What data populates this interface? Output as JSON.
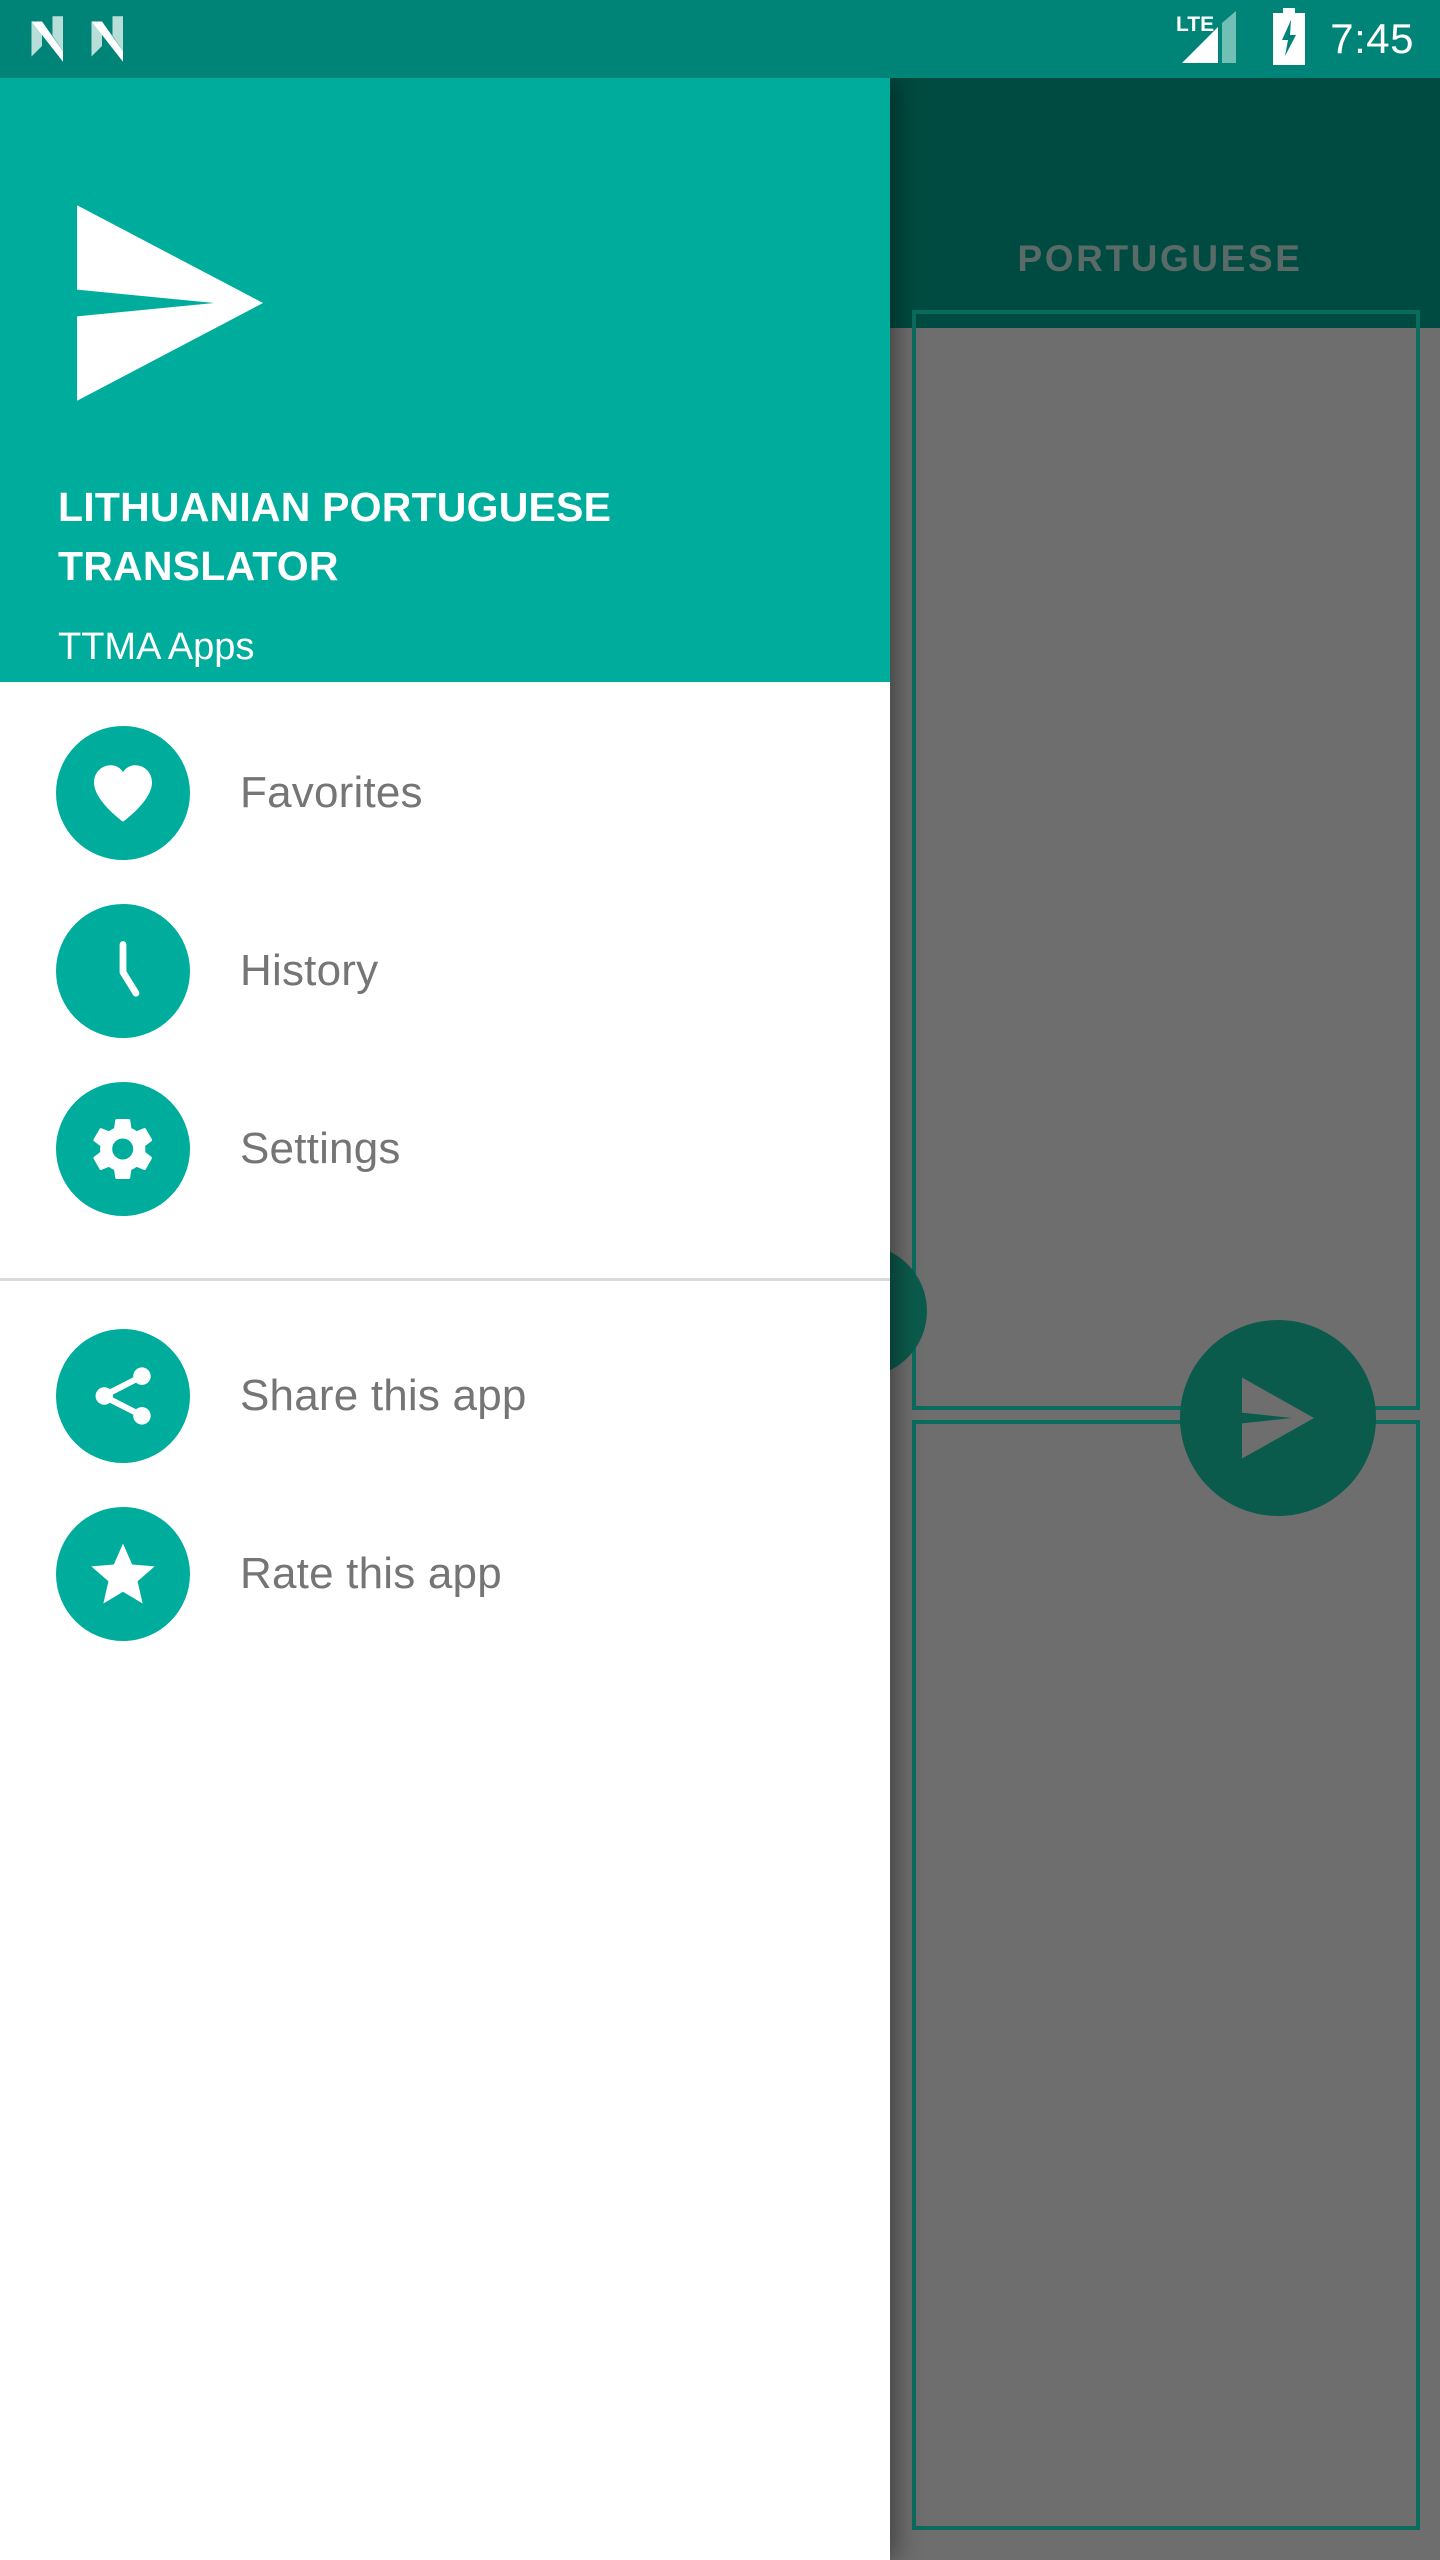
{
  "status_bar": {
    "notification_icons": [
      "n-notification-icon",
      "n-notification-icon"
    ],
    "network_label": "LTE",
    "signal_icon": "signal-bars-icon",
    "battery_icon": "battery-charging-icon",
    "time": "7:45",
    "background_color": "#008478",
    "foreground_color": "#ffffff"
  },
  "drawer": {
    "header": {
      "logo_icon": "paper-plane-send-icon",
      "title": "LITHUANIAN PORTUGUESE TRANSLATOR",
      "subtitle": "TTMA Apps",
      "background_color": "#00ad9c",
      "text_color": "#ffffff"
    },
    "accent_color": "#00ad9c",
    "label_color": "#757575",
    "primary_items": [
      {
        "label": "Favorites",
        "icon": "heart-icon"
      },
      {
        "label": "History",
        "icon": "clock-icon"
      },
      {
        "label": "Settings",
        "icon": "gear-icon"
      }
    ],
    "secondary_items": [
      {
        "label": "Share this app",
        "icon": "share-icon"
      },
      {
        "label": "Rate this app",
        "icon": "star-icon"
      }
    ]
  },
  "app_background": {
    "toolbar": {
      "tab_label": "PORTUGUESE",
      "background_color": "#004b41",
      "tab_text_color": "#5a6a67"
    },
    "scrim_color": "#6e6e6e",
    "field_border_color": "#0a6c5d",
    "source_textbox_value": "",
    "target_textbox_value": "",
    "fab_send_icon": "send-icon",
    "fab_send_color": "#0b5b4c",
    "secondary_button_icon": "circle-button-icon"
  }
}
